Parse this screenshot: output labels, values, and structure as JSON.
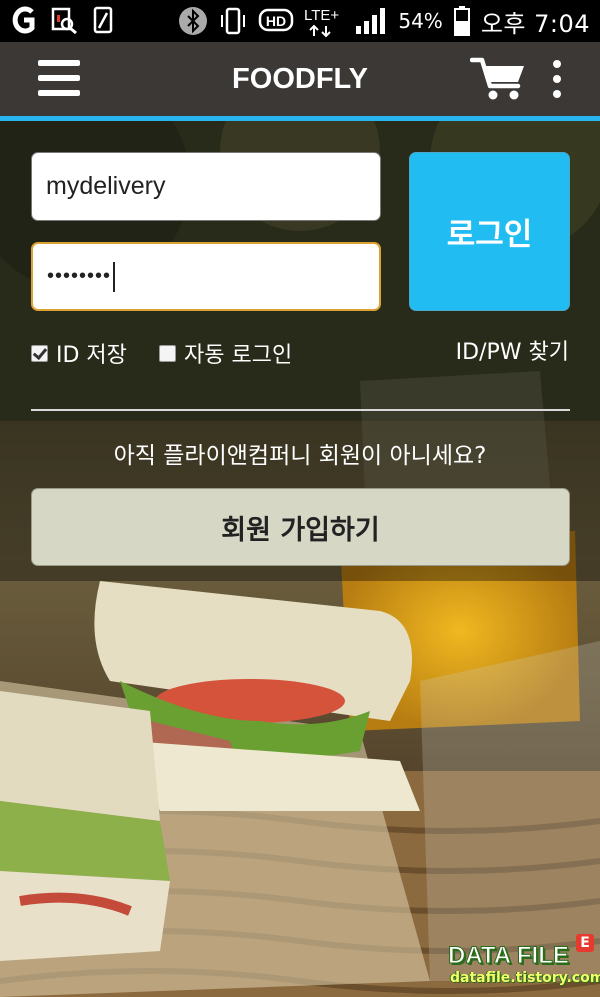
{
  "status_bar": {
    "battery_percent": "54%",
    "time": "오후 7:04",
    "network": "LTE+",
    "hd_label": "HD",
    "icons": [
      "app-g-icon",
      "screenshot-icon",
      "sim-icon",
      "bluetooth-icon",
      "vibrate-icon",
      "hd-voice-icon",
      "lte-icon",
      "signal-icon",
      "battery-icon"
    ]
  },
  "app_bar": {
    "title": "FOODFLY",
    "accent_color": "#29b6f0",
    "icons": [
      "menu-icon",
      "cart-icon",
      "more-icon"
    ]
  },
  "login_form": {
    "id_value": "mydelivery",
    "password_value": "••••••••",
    "login_label": "로그인",
    "save_id_label": "ID 저장",
    "save_id_checked": true,
    "auto_login_label": "자동 로그인",
    "auto_login_checked": false,
    "find_label": "ID/PW 찾기",
    "login_color": "#21bdf2"
  },
  "signup": {
    "notice": "아직 플라이앤컴퍼니 회원이 아니세요?",
    "button_label": "회원 가입하기"
  },
  "watermark": {
    "title": "DATA FILE",
    "badge": "E",
    "url": "datafile.tistory.com"
  }
}
